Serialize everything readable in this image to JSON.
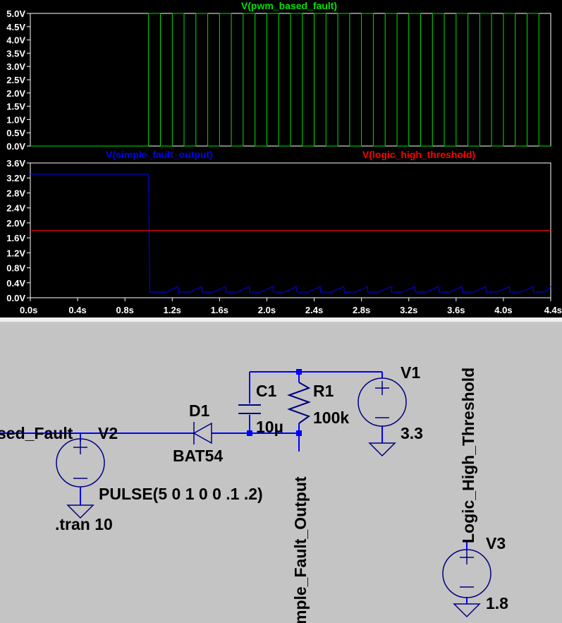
{
  "colors": {
    "plot_bg": "#000000",
    "axis_text": "#ffffff",
    "pwm_trace": "#00e000",
    "simple_trace": "#0000ff",
    "threshold_trace": "#ff0000",
    "schematic_bg": "#c4c4c4",
    "wire": "#0000ff",
    "component": "#000080",
    "node_dot": "#0000ff"
  },
  "chart_data": [
    {
      "type": "line",
      "title": "V(pwm_based_fault)",
      "xlim": [
        0,
        4.4
      ],
      "ylim": [
        0,
        5.0
      ],
      "yticks": [
        "5.0V",
        "4.5V",
        "4.0V",
        "3.5V",
        "3.0V",
        "2.5V",
        "2.0V",
        "1.5V",
        "1.0V",
        "0.5V",
        "0.0V"
      ],
      "series": [
        {
          "name": "V(pwm_based_fault)",
          "color": "#00e000",
          "x": [
            0,
            1.0,
            1.0,
            1.1,
            1.1,
            1.2
          ],
          "y": [
            0,
            0,
            5,
            5,
            0,
            0
          ]
        }
      ],
      "pulse": {
        "v_low": 0,
        "v_high": 5,
        "delay": 1.0,
        "on_time": 0.1,
        "period": 0.2
      }
    },
    {
      "type": "line",
      "xlim": [
        0,
        4.4
      ],
      "ylim": [
        0,
        3.6
      ],
      "yticks": [
        "3.6V",
        "3.2V",
        "2.8V",
        "2.4V",
        "2.0V",
        "1.6V",
        "1.2V",
        "0.8V",
        "0.4V",
        "0.0V"
      ],
      "xticks": [
        "0.0s",
        "0.4s",
        "0.8s",
        "1.2s",
        "1.6s",
        "2.0s",
        "2.4s",
        "2.8s",
        "3.2s",
        "3.6s",
        "4.0s",
        "4.4s"
      ],
      "series": [
        {
          "name": "V(simple_fault_output)",
          "color": "#0000ff",
          "x": [
            0,
            1.0,
            1.01,
            1.05,
            1.1,
            1.2
          ],
          "y": [
            3.3,
            3.3,
            0.15,
            0.15,
            0.15,
            0.3
          ]
        },
        {
          "name": "V(logic_high_threshold)",
          "color": "#ff0000",
          "x": [
            0,
            4.4
          ],
          "y": [
            1.8,
            1.8
          ]
        }
      ]
    }
  ],
  "schematic": {
    "net_left": "sed_Fault",
    "v2": {
      "name": "V2",
      "value": "PULSE(5 0 1 0 0 .1 .2)"
    },
    "tran": ".tran 10",
    "d1": {
      "name": "D1",
      "model": "BAT54"
    },
    "c1": {
      "name": "C1",
      "value": "10µ"
    },
    "r1": {
      "name": "R1",
      "value": "100k"
    },
    "v1": {
      "name": "V1",
      "value": "3.3"
    },
    "v3": {
      "name": "V3",
      "value": "1.8"
    },
    "net_output": "mple_Fault_Output",
    "net_threshold": "Logic_High_Threshold"
  }
}
